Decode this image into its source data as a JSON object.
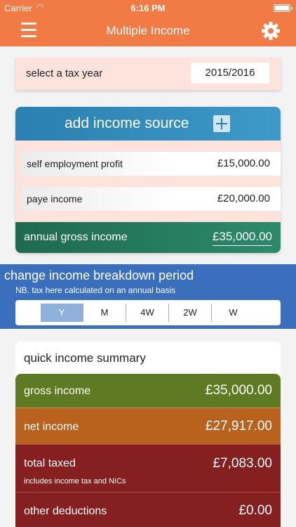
{
  "status_bar": {
    "carrier": "Carrier",
    "time": "6:16 PM"
  },
  "nav": {
    "title": "Multiple Income",
    "menu_icon": "hamburger-menu-icon",
    "settings_icon": "gear-icon"
  },
  "tax_year": {
    "label": "select a tax year",
    "value": "2015/2016"
  },
  "income": {
    "add_label": "add income source",
    "add_icon": "plus-icon",
    "sources": [
      {
        "name": "self employment profit",
        "amount": "£15,000.00"
      },
      {
        "name": "paye income",
        "amount": "£20,000.00"
      }
    ],
    "gross_label": "annual gross income",
    "gross_amount": "£35,000.00"
  },
  "period": {
    "title": "change income breakdown period",
    "note": "NB. tax here calculated on an annual basis",
    "options": [
      "Y",
      "M",
      "4W",
      "2W",
      "W"
    ],
    "selected": "Y"
  },
  "summary": {
    "title": "quick income summary",
    "gross": {
      "label": "gross income",
      "amount": "£35,000.00"
    },
    "net": {
      "label": "net income",
      "amount": "£27,917.00"
    },
    "taxed": {
      "label": "total taxed",
      "amount": "£7,083.00",
      "note": "includes income tax and NICs"
    },
    "other": {
      "label": "other deductions",
      "amount": "£0.00"
    }
  },
  "colors": {
    "accent": "#f27a45",
    "blue": "#2a80b0",
    "green": "#1e6a50",
    "period": "#3a6fbd",
    "olive": "#5e7b23",
    "orange": "#b8621e",
    "maroon": "#862020"
  }
}
